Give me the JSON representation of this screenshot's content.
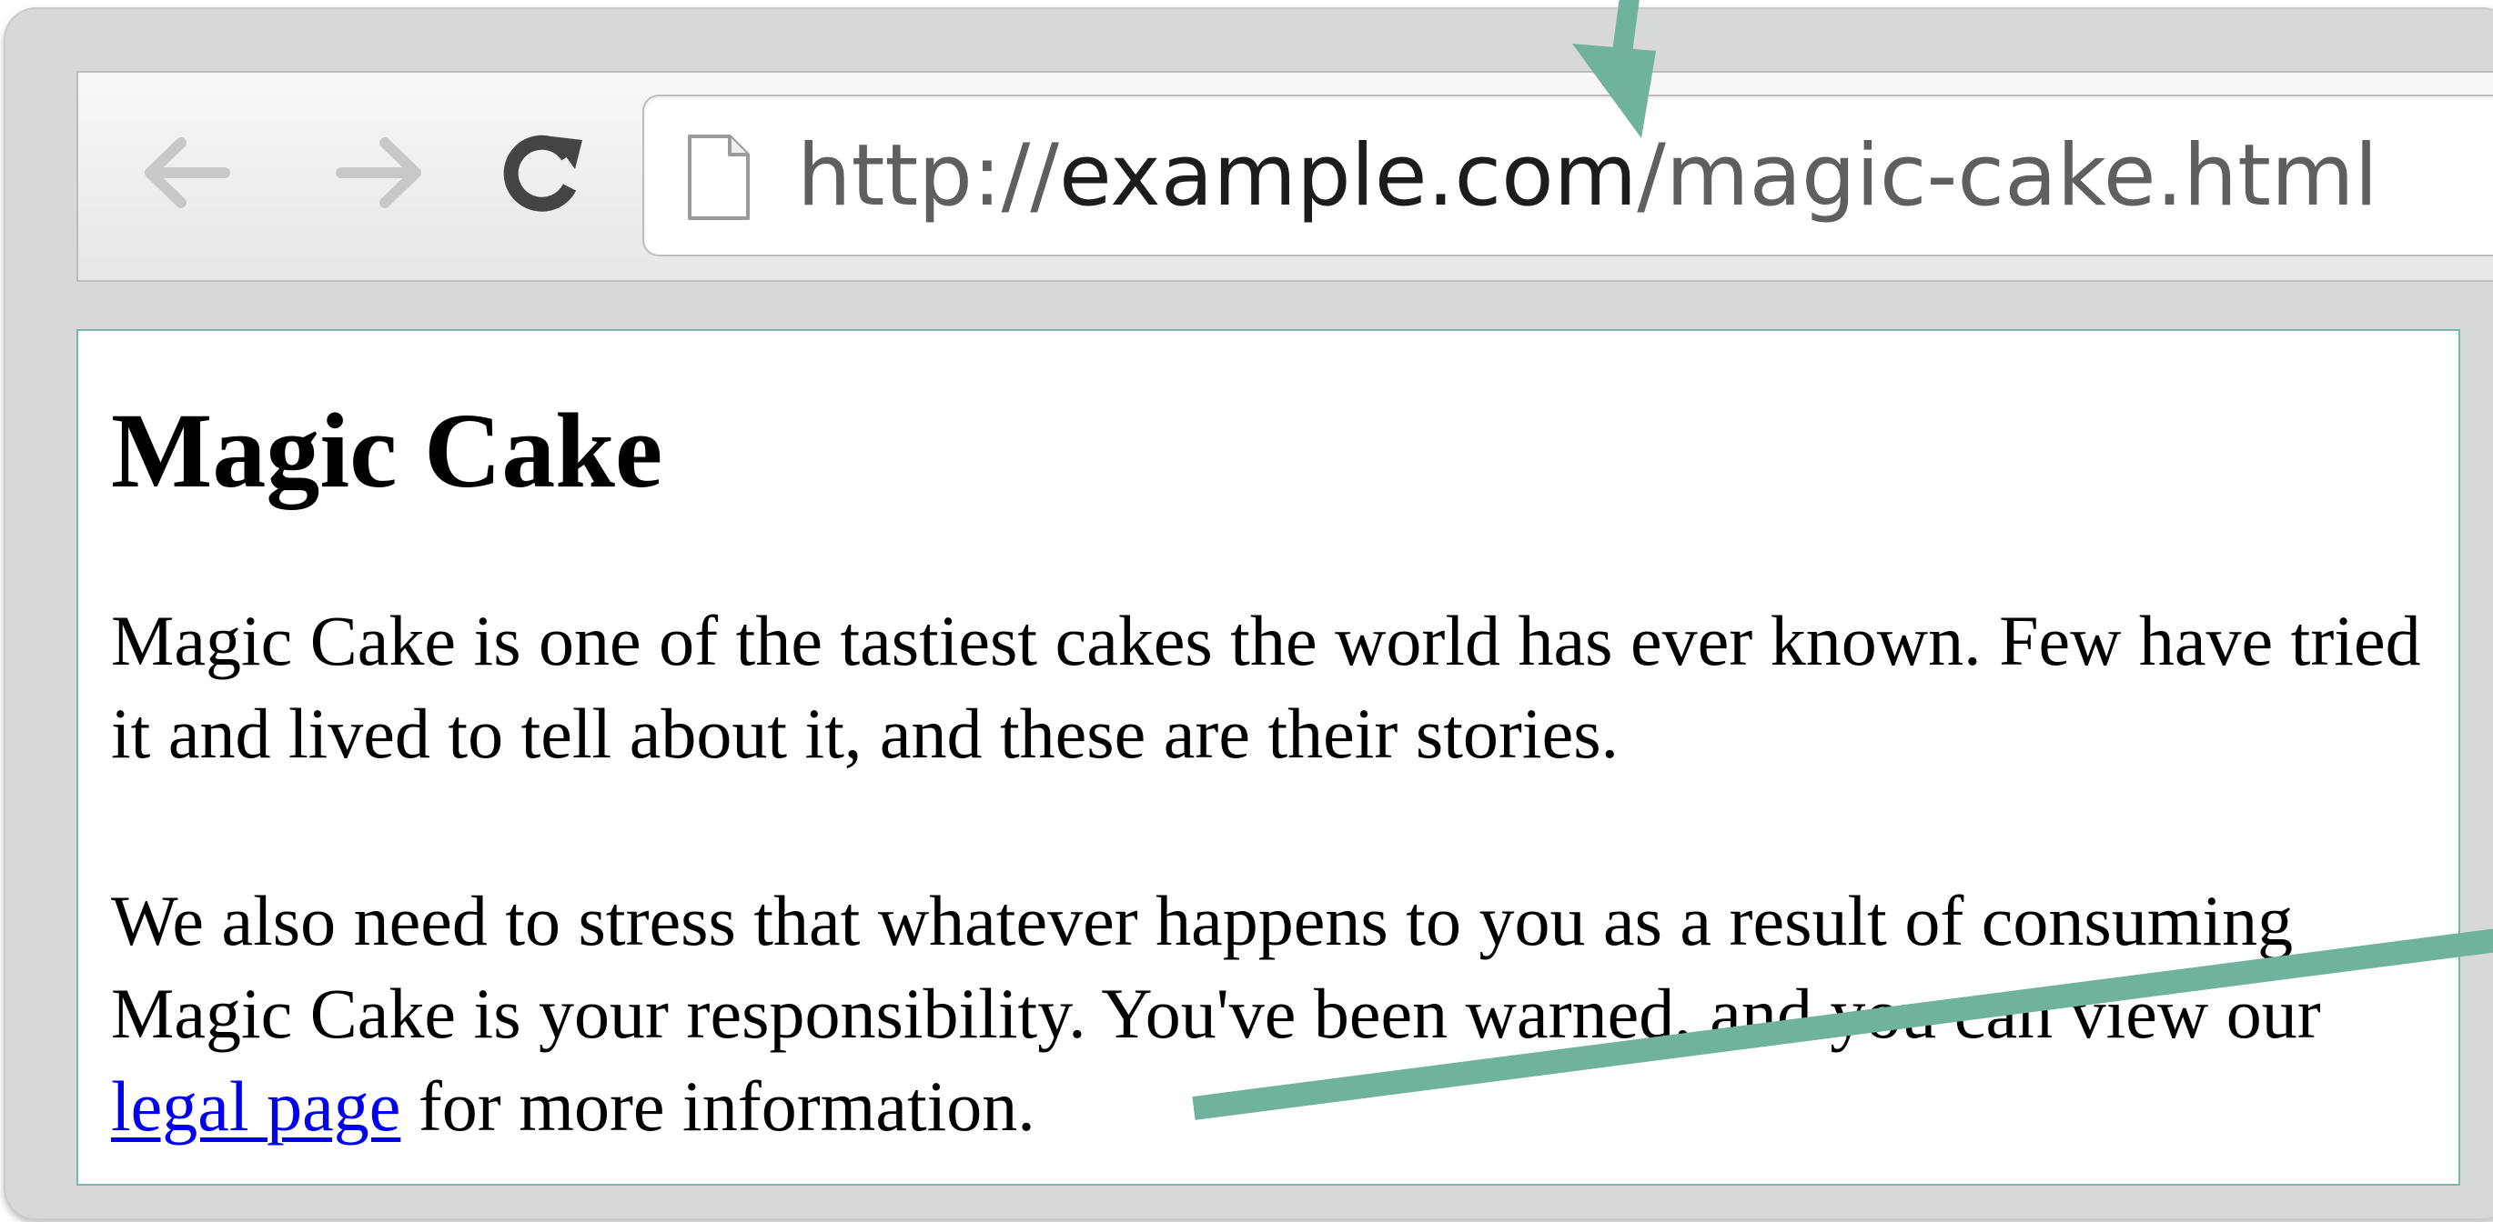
{
  "browser": {
    "url_scheme": "http://",
    "url_domain": "example.com",
    "url_path": "/magic-cake.html",
    "icons": {
      "back": "arrow-left-icon",
      "forward": "arrow-right-icon",
      "reload": "reload-icon",
      "page": "page-icon"
    }
  },
  "page": {
    "title": "Magic Cake",
    "paragraph_1": "Magic Cake is one of the tastiest cakes the world has ever known. Few have tried it and lived to tell about it, and these are their stories.",
    "paragraph_2_before_link": "We also need to stress that whatever happens to you as a result of consuming Magic Cake is your responsibility. You've been warned, and you can view our ",
    "link_text": "legal page",
    "paragraph_2_after_link": " for more information."
  },
  "colors": {
    "annotation_arrow": "#6fb29d",
    "link": "#0000ee",
    "content_border": "#79b8a6"
  }
}
